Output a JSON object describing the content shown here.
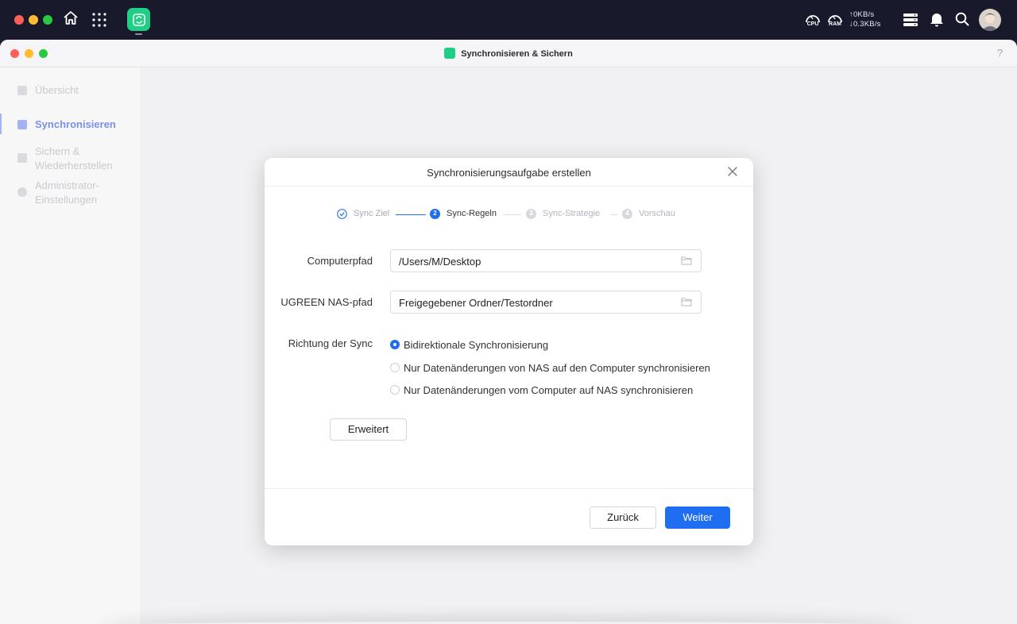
{
  "colors": {
    "accent": "#1f6df0",
    "app_green": "#1fcf86",
    "topbar": "#181a2c",
    "traffic_red": "#ff5f57",
    "traffic_yellow": "#febc2e",
    "traffic_green": "#28c840"
  },
  "topbar": {
    "icons": [
      "home-icon",
      "app-grid-icon",
      "sync-app-icon",
      "cpu-gauge-icon",
      "ram-gauge-icon",
      "server-list-icon",
      "bell-icon",
      "search-icon",
      "avatar"
    ],
    "cpu_label": "CPU",
    "ram_label": "RAM",
    "upload": "↑0KB/s",
    "download": "↓0.3KB/s"
  },
  "window": {
    "title": "Synchronisieren & Sichern",
    "help": "?"
  },
  "sidebar": {
    "items": [
      {
        "label": "Übersicht",
        "icon": "overview-icon",
        "active": false
      },
      {
        "label": "Synchronisieren",
        "icon": "sync-list-icon",
        "active": true
      },
      {
        "label": "Sichern & Wiederherstellen",
        "icon": "backup-icon",
        "active": false
      },
      {
        "label": "Administrator-Einstellungen",
        "icon": "settings-gear-icon",
        "active": false
      }
    ]
  },
  "dialog": {
    "title": "Synchronisierungsaufgabe erstellen",
    "steps": [
      {
        "label": "Sync Ziel",
        "state": "done"
      },
      {
        "label": "Sync-Regeln",
        "number": "2",
        "state": "current"
      },
      {
        "label": "Sync-Strategie",
        "number": "3",
        "state": "pending"
      },
      {
        "label": "Vorschau",
        "number": "4",
        "state": "pending"
      }
    ],
    "computer_path_label": "Computerpfad",
    "computer_path_value": "/Users/M/Desktop",
    "nas_path_label": "UGREEN NAS-pfad",
    "nas_path_value": "Freigegebener Ordner/Testordner",
    "direction_label": "Richtung der Sync",
    "directions": [
      {
        "label": "Bidirektionale Synchronisierung",
        "selected": true
      },
      {
        "label": "Nur Datenänderungen von NAS auf den Computer synchronisieren",
        "selected": false
      },
      {
        "label": "Nur Datenänderungen vom Computer auf NAS synchronisieren",
        "selected": false
      }
    ],
    "advanced_button": "Erweitert",
    "back_button": "Zurück",
    "next_button": "Weiter"
  }
}
